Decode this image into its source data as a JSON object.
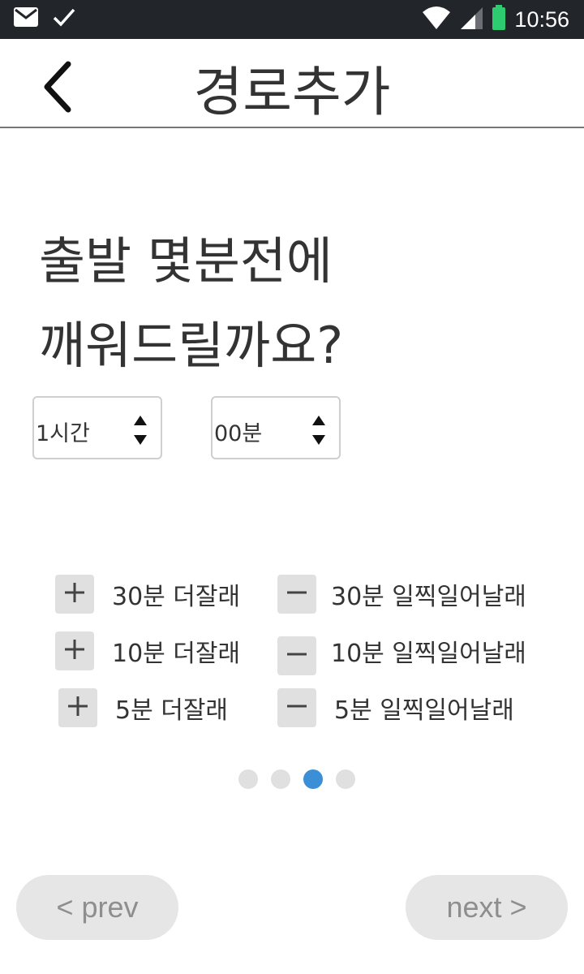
{
  "status_bar": {
    "time": "10:56",
    "icons": [
      "mail-icon",
      "check-icon",
      "wifi-icon",
      "signal-icon",
      "battery-icon"
    ]
  },
  "header": {
    "back_icon": "chevron-left-icon",
    "title": "경로추가"
  },
  "question": {
    "line1": "출발 몇분전에",
    "line2": "깨워드릴까요?"
  },
  "pickers": {
    "hours": {
      "value": "1시간"
    },
    "minutes": {
      "value": "00분"
    }
  },
  "adjustments": [
    {
      "sign": "+",
      "label": "30분 더잘래"
    },
    {
      "sign": "+",
      "label": "10분 더잘래"
    },
    {
      "sign": "+",
      "label": "5분 더잘래"
    },
    {
      "sign": "−",
      "label": "30분 일찍일어날래"
    },
    {
      "sign": "−",
      "label": "10분 일찍일어날래"
    },
    {
      "sign": "−",
      "label": "5분 일찍일어날래"
    }
  ],
  "pagination": {
    "total": 4,
    "current": 3
  },
  "navigation": {
    "prev_label": "< prev",
    "next_label": "next >"
  },
  "colors": {
    "status_bar": "#22262b",
    "active_dot": "#3a8fd6",
    "inactive_dot": "#e0e0e0",
    "button_bg": "#e6e6e6",
    "battery": "#2ecc71"
  }
}
